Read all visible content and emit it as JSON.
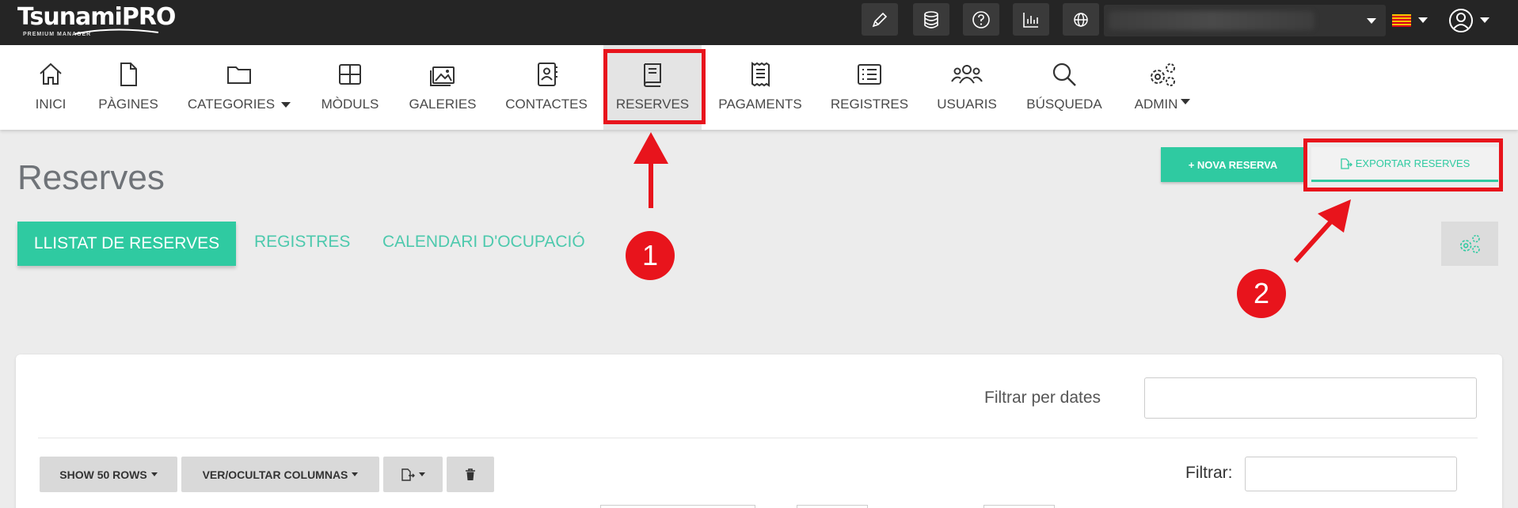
{
  "topbar": {
    "logo_text": "TsunamiPRO",
    "logo_sub": "PREMIUM MANAGER",
    "icons": [
      "pencil-icon",
      "database-icon",
      "help-icon",
      "chart-icon",
      "globe-icon",
      "user-circle-icon"
    ]
  },
  "nav": {
    "items": [
      {
        "label": "INICI",
        "icon": "home-icon"
      },
      {
        "label": "PÀGINES",
        "icon": "file-icon"
      },
      {
        "label": "CATEGORIES",
        "icon": "folder-icon"
      },
      {
        "label": "MÒDULS",
        "icon": "grid-icon"
      },
      {
        "label": "GALERIES",
        "icon": "images-icon"
      },
      {
        "label": "CONTACTES",
        "icon": "contact-book-icon"
      },
      {
        "label": "RESERVES",
        "icon": "book-icon"
      },
      {
        "label": "PAGAMENTS",
        "icon": "receipt-icon"
      },
      {
        "label": "REGISTRES",
        "icon": "list-icon"
      },
      {
        "label": "USUARIS",
        "icon": "users-icon"
      },
      {
        "label": "BÚSQUEDA",
        "icon": "search-icon"
      },
      {
        "label": "ADMIN",
        "icon": "gears-icon"
      }
    ]
  },
  "page": {
    "title": "Reserves",
    "nova_label": "+ NOVA RESERVA",
    "export_label": "EXPORTAR RESERVES",
    "tabs": [
      "LLISTAT DE RESERVES",
      "REGISTRES",
      "CALENDARI D'OCUPACIÓ"
    ]
  },
  "table": {
    "filter_dates_label": "Filtrar per dates",
    "show_rows_label": "SHOW 50 ROWS",
    "columns_label": "VER/OCULTAR COLUMNAS",
    "filter_label": "Filtrar:"
  },
  "annotations": {
    "badge_1": "1",
    "badge_2": "2",
    "color": "#e8141c"
  },
  "colors": {
    "accent": "#2fcaa1",
    "topbar": "#252525"
  }
}
